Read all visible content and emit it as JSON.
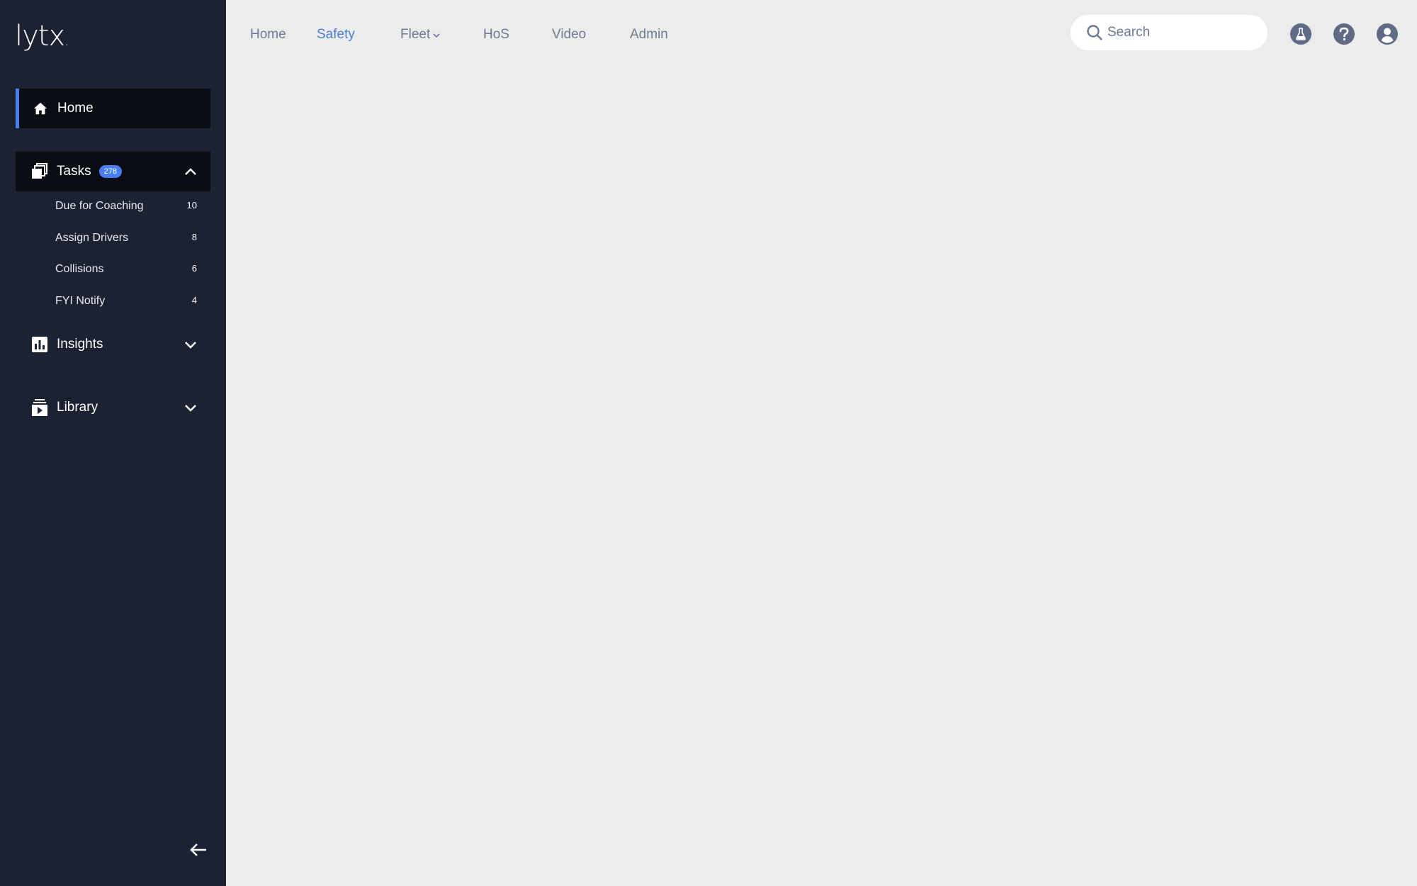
{
  "brand": {
    "logo_text": "lytx",
    "logo_dot": "."
  },
  "sidebar": {
    "home": {
      "label": "Home",
      "icon": "home-icon"
    },
    "tasks": {
      "label": "Tasks",
      "badge": "278",
      "icon": "tasks-icon",
      "expanded": true,
      "items": [
        {
          "label": "Due for Coaching",
          "count": "10"
        },
        {
          "label": "Assign Drivers",
          "count": "8"
        },
        {
          "label": "Collisions",
          "count": "6"
        },
        {
          "label": "FYI Notify",
          "count": "4"
        }
      ]
    },
    "insights": {
      "label": "Insights",
      "icon": "insights-chart-icon",
      "expanded": false
    },
    "library": {
      "label": "Library",
      "icon": "library-video-icon",
      "expanded": false
    },
    "collapse_icon": "arrow-left-icon"
  },
  "topnav": {
    "tabs": [
      {
        "label": "Home",
        "active": false
      },
      {
        "label": "Safety",
        "active": true
      },
      {
        "label": "Fleet",
        "active": false,
        "dropdown": true
      },
      {
        "label": "HoS",
        "active": false
      },
      {
        "label": "Video",
        "active": false
      },
      {
        "label": "Admin",
        "active": false
      }
    ],
    "search": {
      "placeholder": "Search",
      "value": ""
    },
    "icons": [
      "flask-icon",
      "help-icon",
      "user-account-icon"
    ]
  },
  "colors": {
    "sidebar_bg": "#1c2232",
    "active_accent": "#4a7df0",
    "content_bg": "#ececec",
    "tab_text": "#6d7a93",
    "tab_active": "#4a7dd6"
  }
}
